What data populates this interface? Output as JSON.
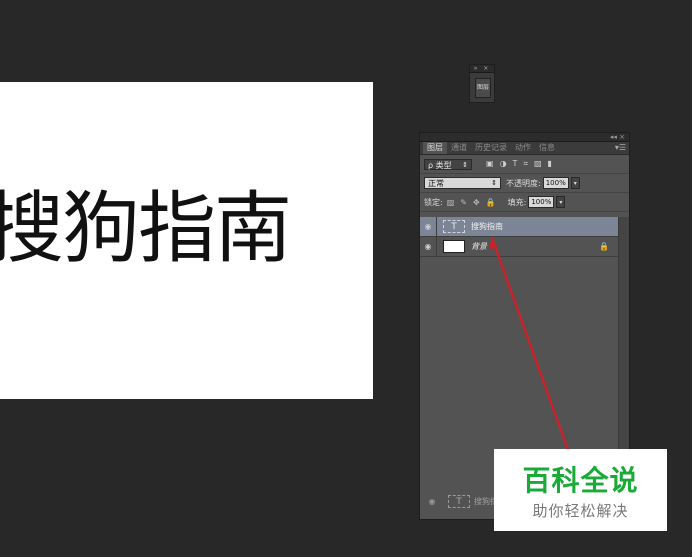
{
  "canvas": {
    "text": "搜狗指南"
  },
  "mini_dock": {
    "arrows": "» ×",
    "icon_label": "图层"
  },
  "panel": {
    "top_controls": "◂◂ ×",
    "tabs": [
      {
        "label": "图层",
        "active": true
      },
      {
        "label": "通道",
        "active": false
      },
      {
        "label": "历史记录",
        "active": false
      },
      {
        "label": "动作",
        "active": false
      },
      {
        "label": "信息",
        "active": false
      }
    ],
    "tab_menu": "▾☰",
    "filter": {
      "label": "ρ 类型",
      "caret": "⇕",
      "icons": [
        "▣",
        "◑",
        "T",
        "⌗",
        "▨",
        "▮"
      ]
    },
    "blend": {
      "mode": "正常",
      "caret": "⇕",
      "opacity_label": "不透明度:",
      "opacity_value": "100%",
      "arrow": "▾"
    },
    "lock": {
      "label": "锁定:",
      "icons": [
        "▨",
        "✎",
        "✥",
        "🔒"
      ],
      "fill_label": "填充:",
      "fill_value": "100%",
      "arrow": "▾"
    },
    "layers": [
      {
        "name": "搜狗指南",
        "type": "text",
        "selected": true,
        "thumb": "T"
      },
      {
        "name": "背景",
        "type": "image",
        "selected": false,
        "locked": true
      }
    ],
    "ghost_layer": {
      "name": "搜狗指",
      "thumb": "T"
    }
  },
  "watermark": {
    "title": "百科全说",
    "subtitle": "助你轻松解决"
  },
  "colors": {
    "accent_arrow": "#c8232b",
    "watermark_green": "#1aaa38",
    "selected_layer": "#7b8596"
  }
}
